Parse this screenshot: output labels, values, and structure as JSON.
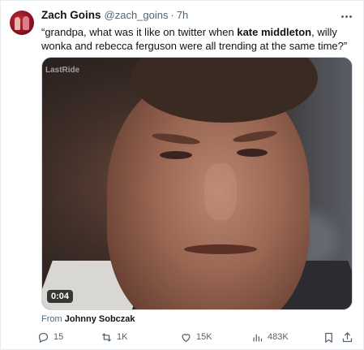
{
  "tweet": {
    "display_name": "Zach Goins",
    "handle": "@zach_goins",
    "separator": "·",
    "time": "7h",
    "text_before": "“grandpa, what was it like on twitter when ",
    "text_bold": "kate middleton",
    "text_after": ", willy wonka and rebecca ferguson were all trending at the same time?”",
    "more_icon": "more-horizontal-icon"
  },
  "media": {
    "watermark": "LastRide",
    "duration": "0:04"
  },
  "attribution": {
    "prefix": "From ",
    "name": "Johnny Sobczak"
  },
  "actions": {
    "replies": "15",
    "reposts": "1K",
    "likes": "15K",
    "views": "483K"
  },
  "icons": {
    "reply": "reply-icon",
    "repost": "repost-icon",
    "like": "heart-icon",
    "views": "views-icon",
    "bookmark": "bookmark-icon",
    "share": "share-icon"
  },
  "colors": {
    "text": "#0f1419",
    "secondary": "#536471",
    "border": "#cfd9de"
  }
}
